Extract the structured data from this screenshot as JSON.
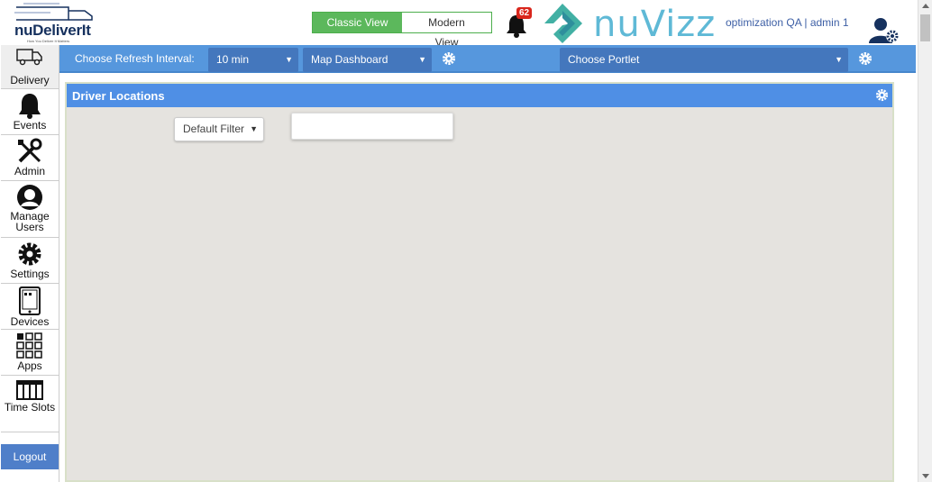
{
  "header": {
    "logo_name": "nuDeliverIt",
    "logo_tagline": "How You Deliver It Matters",
    "view_classic": "Classic View",
    "view_modern": "Modern View",
    "notification_count": "62",
    "brand": "nuVizz",
    "user_info": "optimization QA | admin 1"
  },
  "sidebar": {
    "items": [
      {
        "label": "Delivery",
        "icon": "truck-icon"
      },
      {
        "label": "Events",
        "icon": "bell-icon"
      },
      {
        "label": "Admin",
        "icon": "tools-icon"
      },
      {
        "label": "Manage Users",
        "icon": "user-icon"
      },
      {
        "label": "Settings",
        "icon": "gear-icon"
      },
      {
        "label": "Devices",
        "icon": "tablet-icon"
      },
      {
        "label": "Apps",
        "icon": "grid-icon"
      },
      {
        "label": "Time Slots",
        "icon": "calendar-icon"
      }
    ],
    "logout": "Logout"
  },
  "toolbar": {
    "refresh_label": "Choose Refresh Interval:",
    "refresh_value": "10 min",
    "dashboard_value": "Map Dashboard",
    "portlet_placeholder": "Choose Portlet"
  },
  "panel": {
    "title": "Driver Locations",
    "filter_value": "Default Filter"
  },
  "colors": {
    "toolbar": "#5697dd",
    "panel_header": "#4f8fe5",
    "classic_active": "#5cb85c",
    "badge": "#d9261c"
  }
}
